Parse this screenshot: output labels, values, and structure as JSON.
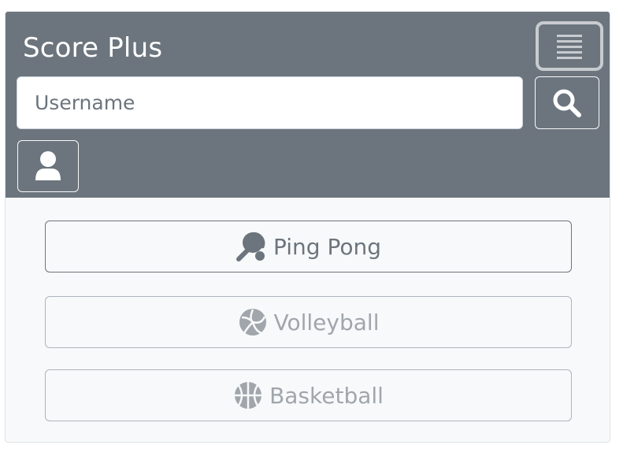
{
  "app": {
    "brand": "Score Plus"
  },
  "header": {
    "search": {
      "placeholder": "Username",
      "value": ""
    }
  },
  "sports": [
    {
      "label": "Ping Pong",
      "icon": "ping-pong-paddle-icon",
      "active": true
    },
    {
      "label": "Volleyball",
      "icon": "volleyball-icon",
      "active": false
    },
    {
      "label": "Basketball",
      "icon": "basketball-icon",
      "active": false
    }
  ],
  "colors": {
    "navbar": "#6c757d",
    "body": "#f8f9fa",
    "active_text": "#6c757d",
    "inactive_text": "#a0a6ac"
  }
}
